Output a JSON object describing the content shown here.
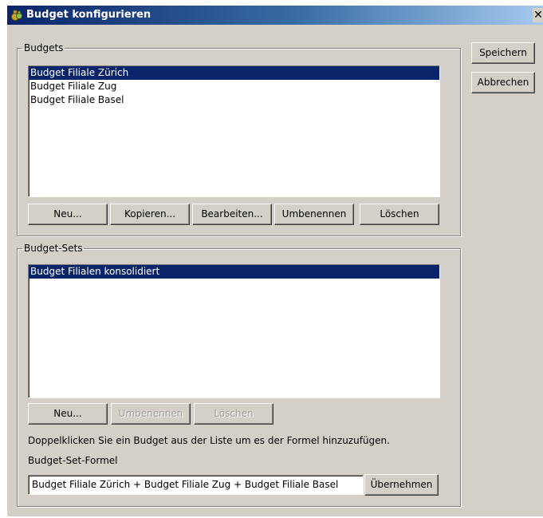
{
  "window": {
    "title": "Budget konfigurieren",
    "close_glyph": "✕",
    "icon": "money-bag-icon"
  },
  "side_buttons": {
    "save_label": "Speichern",
    "cancel_label": "Abbrechen"
  },
  "budgets": {
    "legend": "Budgets",
    "items": [
      {
        "label": "Budget Filiale Zürich",
        "selected": true
      },
      {
        "label": "Budget Filiale Zug",
        "selected": false
      },
      {
        "label": "Budget Filiale Basel",
        "selected": false
      }
    ],
    "buttons": {
      "new": "Neu...",
      "copy": "Kopieren...",
      "edit": "Bearbeiten...",
      "rename": "Umbenennen",
      "delete": "Löschen"
    }
  },
  "budget_sets": {
    "legend": "Budget-Sets",
    "items": [
      {
        "label": "Budget Filialen konsolidiert",
        "selected": true
      }
    ],
    "buttons": {
      "new": "Neu...",
      "rename": "Umbenennen",
      "delete": "Löschen"
    },
    "hint": "Doppelklicken Sie ein Budget aus der Liste um es der Formel hinzuzufügen.",
    "formula_label": "Budget-Set-Formel",
    "formula_value": "Budget Filiale Zürich + Budget Filiale Zug + Budget Filiale Basel",
    "apply_label": "Übernehmen"
  }
}
